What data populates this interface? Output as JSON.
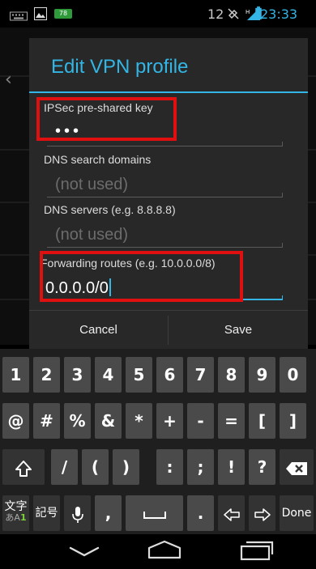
{
  "status_bar": {
    "time": "23:33",
    "notification_count": "12",
    "battery_badge": "78",
    "icons": [
      "keyboard-icon",
      "image-icon",
      "battery-notification-icon",
      "mute-icon",
      "signal-icon",
      "battery-icon"
    ]
  },
  "dialog": {
    "title": "Edit VPN profile",
    "fields": [
      {
        "label": "IPSec pre-shared key",
        "value": "•••",
        "placeholder": ""
      },
      {
        "label": "DNS search domains",
        "value": "",
        "placeholder": "(not used)"
      },
      {
        "label": "DNS servers (e.g. 8.8.8.8)",
        "value": "",
        "placeholder": "(not used)"
      },
      {
        "label": "Forwarding routes (e.g. 10.0.0.0/8)",
        "value": "0.0.0.0/0",
        "placeholder": ""
      }
    ],
    "cancel_label": "Cancel",
    "save_label": "Save"
  },
  "keyboard": {
    "row1": [
      "1",
      "2",
      "3",
      "4",
      "5",
      "6",
      "7",
      "8",
      "9",
      "0"
    ],
    "row2": [
      "@",
      "#",
      "%",
      "&",
      "*",
      "+",
      "-",
      "=",
      "[",
      "]"
    ],
    "row3": [
      "/",
      "(",
      ")",
      ":",
      ";",
      "!",
      "?"
    ],
    "row4": {
      "lang_top": "文字",
      "lang_sub": "あA",
      "lang_sub_num": "1",
      "symbols": "記号",
      "comma": ",",
      "period": ".",
      "done": "Done"
    }
  },
  "colors": {
    "accent": "#33b5e5",
    "highlight": "#e01010",
    "dialog_bg": "#282828"
  }
}
